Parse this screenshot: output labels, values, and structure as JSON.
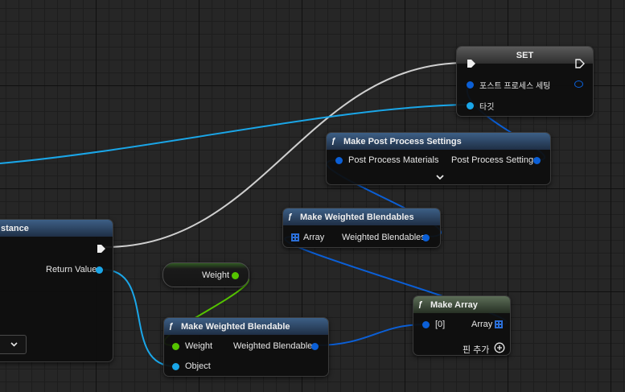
{
  "nodes": {
    "set": {
      "title": "SET",
      "pin_settings": "포스트 프로세스 세팅",
      "pin_target": "타깃"
    },
    "make_pps": {
      "title": "Make Post Process Settings",
      "in_label": "Post Process Materials",
      "out_label": "Post Process Settings",
      "expand_icon": "chevron-down-icon"
    },
    "make_wb_array": {
      "title": "Make Weighted Blendables",
      "in_label": "Array",
      "out_label": "Weighted Blendables"
    },
    "left_node": {
      "title_fragment": "stance",
      "return_label": "Return Value",
      "dropdown_icon": "chevron-down-icon"
    },
    "weight_var": {
      "label": "Weight"
    },
    "make_wb": {
      "title": "Make Weighted Blendable",
      "in_weight": "Weight",
      "in_object": "Object",
      "out_label": "Weighted Blendable"
    },
    "make_array": {
      "title": "Make Array",
      "in_label": "[0]",
      "out_label": "Array",
      "add_pin": "핀 추가"
    }
  },
  "colors": {
    "object_wire": "#1aa6e8",
    "struct_wire": "#0b5fd6",
    "float_wire": "#55c400",
    "exec_wire": "#cfcfcf"
  }
}
